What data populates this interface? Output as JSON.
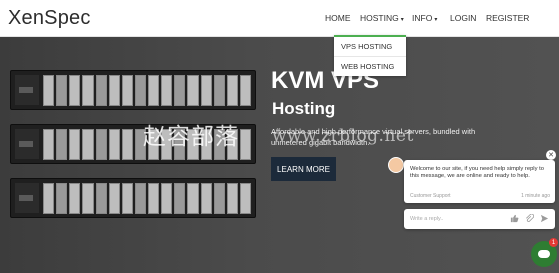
{
  "brand": {
    "logo": "XenSpec"
  },
  "nav": {
    "items": [
      {
        "label": "HOME",
        "caret": ""
      },
      {
        "label": "HOSTING",
        "caret": "▾"
      },
      {
        "label": "INFO",
        "caret": "▾"
      },
      {
        "label": "LOGIN",
        "caret": ""
      },
      {
        "label": "REGISTER",
        "caret": ""
      }
    ],
    "dropdown": [
      "VPS HOSTING",
      "WEB HOSTING"
    ]
  },
  "hero": {
    "title": "KVM VPS",
    "subtitle": "Hosting",
    "description": "Affordable and high performance virtual servers, bundled with unmetered gigabit bandwidth.",
    "button": "LEARN MORE"
  },
  "watermark": {
    "text": "赵容部落",
    "url": "www.zrblog.net"
  },
  "chat": {
    "message": "Welcome to our site, if you need help simply reply to this message, we are online and ready to help.",
    "agent": "Customer Support",
    "time": "1 minute ago",
    "input_placeholder": "Write a reply..",
    "close_glyph": "✕",
    "badge": "1",
    "icons": [
      "thumbs-up-icon",
      "paperclip-icon",
      "send-icon"
    ]
  },
  "colors": {
    "accent": "#4caf50",
    "button_dark": "#1c2a3a",
    "chat_green": "#2e7d32",
    "badge_red": "#e53935"
  }
}
